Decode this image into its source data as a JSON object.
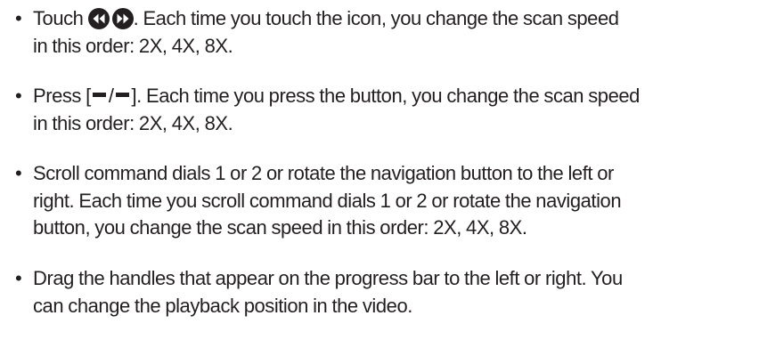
{
  "bullet": "•",
  "icons": {
    "rewind": "rewind-circle-icon",
    "fast_forward": "fast-forward-circle-icon",
    "button_minus": "minus-glyph"
  },
  "items": [
    {
      "before_icons": "Touch ",
      "after_icons": ". Each time you touch the icon, you change the scan speed",
      "line2": "in this order: 2X, 4X, 8X."
    },
    {
      "before_glyph": "Press [",
      "slash": "/",
      "after_glyph": "]. Each time you press the button, you change the scan speed",
      "line2": "in this order: 2X, 4X, 8X."
    },
    {
      "line1": "Scroll command dials 1 or 2 or rotate the navigation button to the left or",
      "line2": "right. Each time you scroll command dials 1 or 2 or rotate the navigation",
      "line3": "button, you change the scan speed in this order: 2X, 4X, 8X."
    },
    {
      "line1": "Drag the handles that appear on the progress bar to the left or right. You",
      "line2": "can change the playback position in the video."
    }
  ]
}
